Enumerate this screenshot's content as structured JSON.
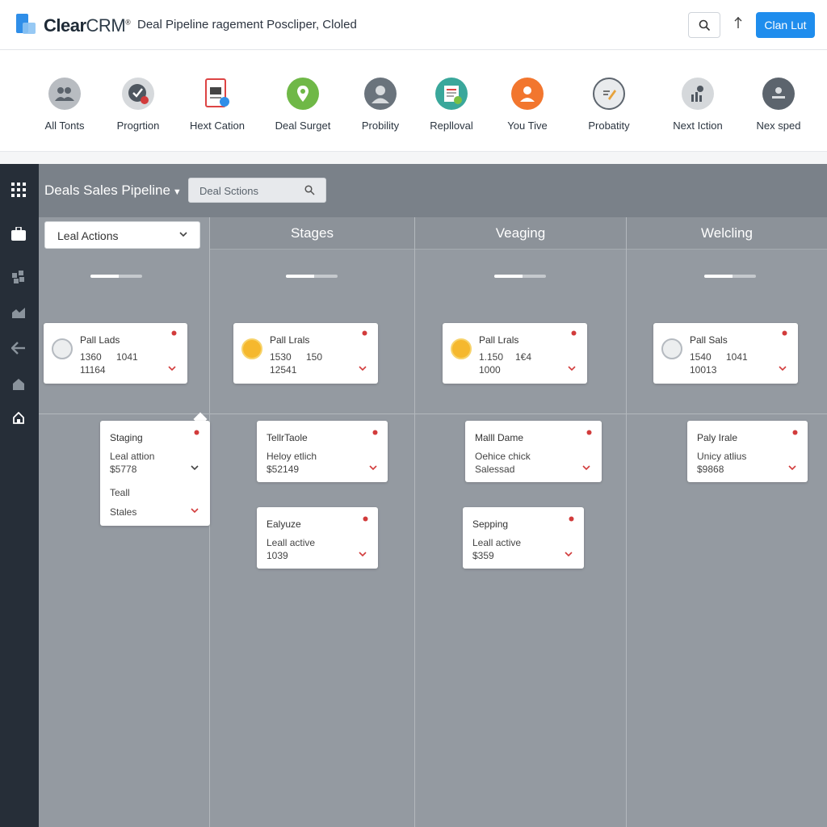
{
  "header": {
    "brand_main": "Clear",
    "brand_accent": "CRM",
    "brand_mark": "®",
    "subtitle": "Deal Pipeline ragement Poscliper, Cloled",
    "primary_button": "Clan Lut"
  },
  "tools": [
    {
      "label": "All Tonts",
      "icon": "people-icon"
    },
    {
      "label": "Progrtion",
      "icon": "check-badge-icon"
    },
    {
      "label": "Hext Cation",
      "icon": "document-icon"
    },
    {
      "label": "Deal Surget",
      "icon": "map-pin-icon"
    },
    {
      "label": "Probility",
      "icon": "user-icon"
    },
    {
      "label": "Replloval",
      "icon": "invoice-icon"
    },
    {
      "label": "You Tive",
      "icon": "person-orange-icon"
    },
    {
      "label": "Probatity",
      "icon": "edit-icon"
    },
    {
      "label": "Next Iction",
      "icon": "chart-icon"
    },
    {
      "label": "Nex sped",
      "icon": "minus-user-icon"
    }
  ],
  "board": {
    "title": "Deals Sales Pipeline",
    "search_placeholder": "Deal Sctions",
    "lead_dropdown": "Leal Actions",
    "columns": [
      {
        "title": "",
        "progress": 0.55
      },
      {
        "title": "Stages",
        "progress": 0.55
      },
      {
        "title": "Veaging",
        "progress": 0.55
      },
      {
        "title": "Welcling",
        "progress": 0.55
      }
    ]
  },
  "cards": {
    "c1": {
      "title": "Pall Lads",
      "a": "1360",
      "b": "1041",
      "c": "11164"
    },
    "c2": {
      "title": "Pall Lrals",
      "a": "1530",
      "b": "150",
      "c": "12541"
    },
    "c3": {
      "title": "Pall Lrals",
      "a": "1.150",
      "b": "1€4",
      "c": "1000"
    },
    "c4": {
      "title": "Pall Sals",
      "a": "1540",
      "b": "1041",
      "c": "10013"
    },
    "s1": {
      "title": "Staging",
      "l1": "Leal attion",
      "l2": "$5778",
      "l3": "Teall",
      "l4": "Stales"
    },
    "s2": {
      "title": "TellrTaole",
      "l1": "Heloy etlich",
      "l2": "$52149"
    },
    "s3": {
      "title": "Malll Dame",
      "l1": "Oehice  chick",
      "l2": "Salessad"
    },
    "s4": {
      "title": "Paly Irale",
      "l1": "Unicy atlius",
      "l2": "$9868"
    },
    "s5": {
      "title": "Ealyuze",
      "l1": "Leall active",
      "l2": "1039"
    },
    "s6": {
      "title": "Sepping",
      "l1": "Leall active",
      "l2": "$359"
    }
  },
  "colors": {
    "accent": "#1f8ded",
    "sidebar": "#262e38",
    "board": "#949aa1",
    "pin": "#d23b3b"
  }
}
